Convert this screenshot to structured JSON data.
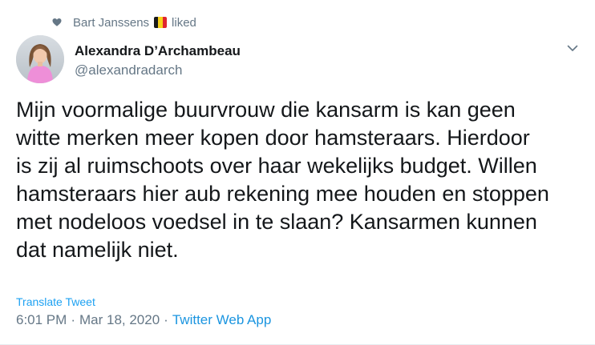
{
  "social_context": {
    "liker_name": "Bart Janssens",
    "action": "liked",
    "flag_colors": [
      "#1a1a1a",
      "#f7d21a",
      "#e0262e"
    ]
  },
  "tweet": {
    "author": {
      "display_name": "Alexandra D’Archambeau",
      "handle": "@alexandradarch"
    },
    "text": "Mijn voormalige buurvrouw die kansarm is kan geen\nwitte merken meer kopen door hamsteraars. Hierdoor\nis zij al ruimschoots over haar wekelijks budget. Willen\nhamsteraars hier aub rekening mee houden en stoppen\nmet nodeloos voedsel in te slaan? Kansarmen kunnen\ndat namelijk niet.",
    "translate_label": "Translate Tweet",
    "time": "6:01 PM",
    "date": "Mar 18, 2020",
    "separator": "·",
    "source": "Twitter Web App"
  },
  "colors": {
    "link": "#1da1f2",
    "muted": "#657786",
    "text": "#14171a"
  },
  "icons": {
    "like": "heart-icon",
    "menu": "chevron-down-icon"
  }
}
